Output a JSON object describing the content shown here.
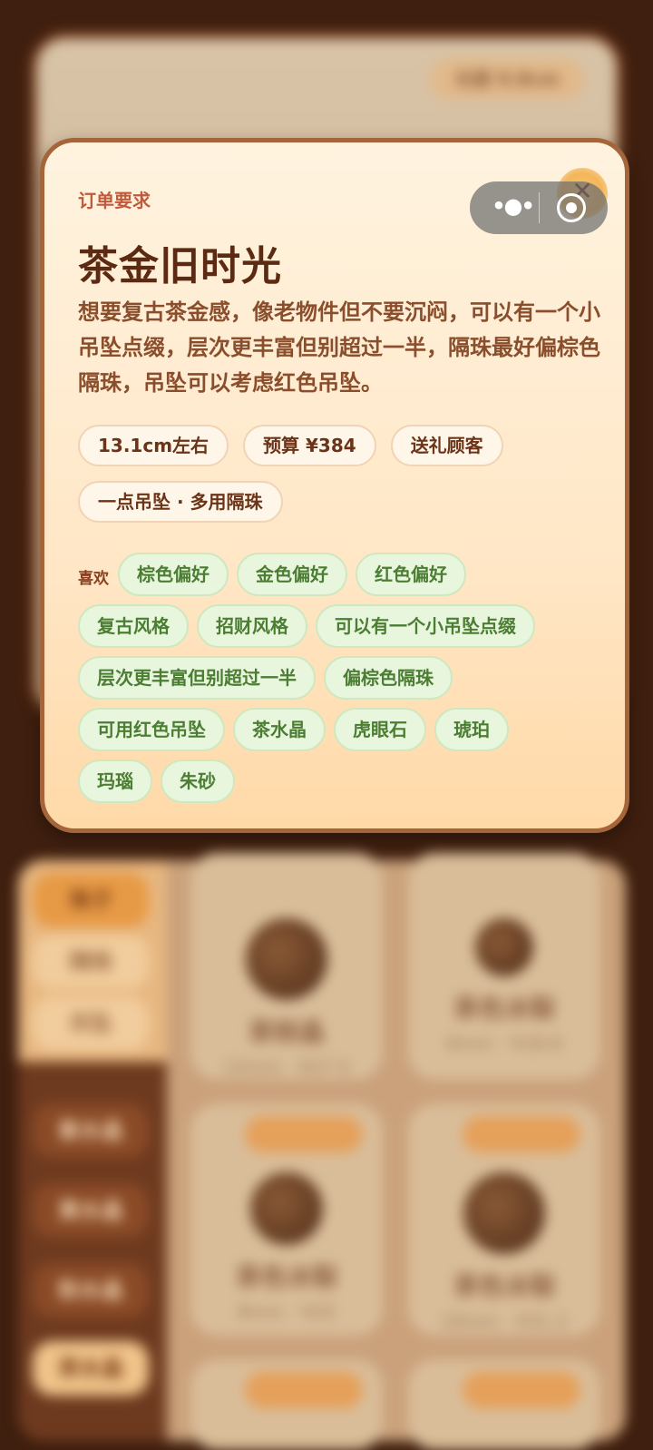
{
  "background": {
    "length_label": "长度 9.8cm",
    "categories_top": [
      "珠子",
      "隔珠",
      "吊坠"
    ],
    "categories_bottom": [
      "紫水晶",
      "黄水晶",
      "粉水晶",
      "茶水晶"
    ],
    "products": [
      {
        "name": "茶棕晶",
        "spec": "12mm · ¥27.5"
      },
      {
        "name": "茶色冰裂",
        "spec": "6mm · ¥18.8"
      },
      {
        "name": "茶色冰裂",
        "spec": "8mm · ¥25"
      },
      {
        "name": "茶色冰裂",
        "spec": "10mm · ¥31.2"
      }
    ]
  },
  "capsule": {
    "more_icon": "more-dots-icon",
    "close_icon": "target-circle-icon"
  },
  "modal": {
    "eyebrow": "订单要求",
    "title": "茶金旧时光",
    "description": "想要复古茶金感，像老物件但不要沉闷，可以有一个小吊坠点缀，层次更丰富但别超过一半，隔珠最好偏棕色隔珠，吊坠可以考虑红色吊坠。",
    "close_label": "✕",
    "requirements": [
      "13.1cm左右",
      "预算 ¥384",
      "送礼顾客",
      "一点吊坠 · 多用隔珠"
    ],
    "likes_label": "喜欢",
    "likes_rows": [
      [
        "棕色偏好",
        "金色偏好",
        "红色偏好"
      ],
      [
        "复古风格",
        "招财风格",
        "可以有一个小吊坠点缀"
      ],
      [
        "层次更丰富但别超过一半",
        "偏棕色隔珠"
      ],
      [
        "可用红色吊坠",
        "茶水晶",
        "虎眼石",
        "琥珀"
      ],
      [
        "玛瑙",
        "朱砂"
      ]
    ]
  },
  "colors": {
    "accent": "#c05a3c",
    "title": "#5c2a12",
    "like_bg": "#e8f6dd",
    "like_text": "#4b7d33"
  }
}
